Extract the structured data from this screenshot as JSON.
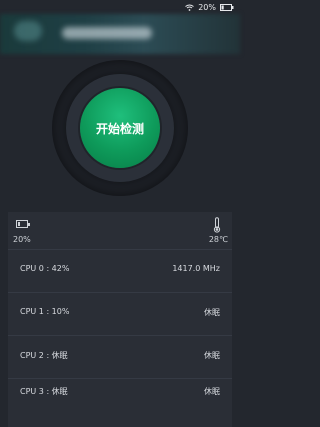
{
  "status_bar": {
    "battery": "20%"
  },
  "main": {
    "start_button_label": "开始检测"
  },
  "summary": {
    "battery_percent": "20%",
    "battery_level": 0.2,
    "temperature": "28℃"
  },
  "cpu_rows": [
    {
      "label": "CPU  0 : 42%",
      "value": "1417.0 MHz"
    },
    {
      "label": "CPU  1 : 10%",
      "value": "休眠"
    },
    {
      "label": "CPU  2 : 休眠",
      "value": "休眠"
    },
    {
      "label": "CPU  3 : 休眠",
      "value": "休眠"
    }
  ],
  "icons": {
    "wifi": "wifi-icon",
    "battery": "battery-icon",
    "thermometer": "thermometer-icon"
  }
}
